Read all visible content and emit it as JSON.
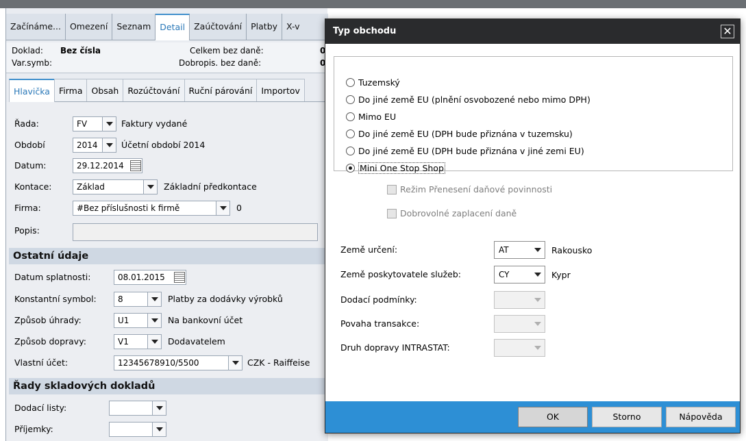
{
  "toptabs": [
    "Začínáme...",
    "Omezení",
    "Seznam",
    "Detail",
    "Zaúčtování",
    "Platby",
    "X-v"
  ],
  "docinfo": {
    "doklad_label": "Doklad:",
    "doklad_value": "Bez čísla",
    "varsymb_label": "Var.symb:",
    "celkem_label": "Celkem bez daně:",
    "celkem_value": "0",
    "dobropis_label": "Dobropis. bez daně:",
    "dobropis_value": "0"
  },
  "subtabs": [
    "Hlavička",
    "Firma",
    "Obsah",
    "Rozúčtování",
    "Ruční párování",
    "Importov"
  ],
  "form": {
    "rada": {
      "label": "Řada:",
      "value": "FV",
      "desc": "Faktury vydané"
    },
    "obdobi": {
      "label": "Období",
      "value": "2014",
      "desc": "Účetní období 2014"
    },
    "datum": {
      "label": "Datum:",
      "value": "29.12.2014"
    },
    "kontace": {
      "label": "Kontace:",
      "value": "Základ",
      "desc": "Základní předkontace"
    },
    "firma": {
      "label": "Firma:",
      "value": "#Bez příslušnosti k firmě",
      "desc": "0"
    },
    "popis": {
      "label": "Popis:",
      "value": ""
    }
  },
  "ostatni": {
    "title": "Ostatní údaje",
    "splatnost": {
      "label": "Datum splatnosti:",
      "value": "08.01.2015"
    },
    "konst": {
      "label": "Konstantní symbol:",
      "value": "8",
      "desc": "Platby za dodávky výrobků"
    },
    "uhrada": {
      "label": "Způsob úhrady:",
      "value": "U1",
      "desc": "Na bankovní účet"
    },
    "doprava": {
      "label": "Způsob dopravy:",
      "value": "V1",
      "desc": "Dodavatelem"
    },
    "ucet": {
      "label": "Vlastní účet:",
      "value": "12345678910/5500",
      "desc": "CZK - Raiffeise"
    }
  },
  "rady": {
    "title": "Řady skladových dokladů",
    "dodaci": {
      "label": "Dodací listy:"
    },
    "prijemky": {
      "label": "Příjemky:"
    }
  },
  "dialog": {
    "title": "Typ obchodu",
    "close": "✕",
    "options": [
      {
        "label": "Tuzemský",
        "selected": false
      },
      {
        "label": "Do jiné země EU (plnění osvobozené nebo mimo DPH)",
        "selected": false
      },
      {
        "label": "Mimo EU",
        "selected": false
      },
      {
        "label": "Do jiné země EU (DPH bude přiznána v tuzemsku)",
        "selected": false
      },
      {
        "label": "Do jiné země EU (DPH bude přiznána v jiné zemi EU)",
        "selected": false
      },
      {
        "label": "Mini One Stop Shop",
        "selected": true
      }
    ],
    "check1": "Režim Přenesení daňové povinnosti",
    "check2": "Dobrovolné zaplacení daně",
    "zeme_urceni": {
      "label": "Země určení:",
      "value": "AT",
      "desc": "Rakousko"
    },
    "zeme_posk": {
      "label": "Země poskytovatele služeb:",
      "value": "CY",
      "desc": "Kypr"
    },
    "dodaci_podm": {
      "label": "Dodací podmínky:"
    },
    "povaha": {
      "label": "Povaha transakce:"
    },
    "druh": {
      "label": "Druh dopravy INTRASTAT:"
    },
    "ok": "OK",
    "storno": "Storno",
    "napoveda": "Nápověda"
  },
  "colors": {
    "accent": "#2d8fd5",
    "titlebar": "#2a2b2d",
    "section": "#cfd8e3"
  }
}
